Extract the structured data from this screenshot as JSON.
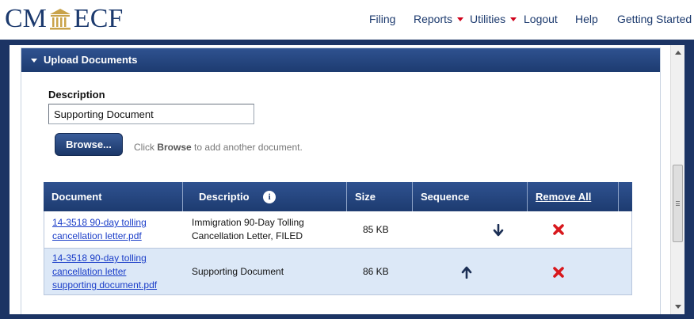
{
  "logo": {
    "left": "CM",
    "right": "ECF"
  },
  "nav": {
    "filing": "Filing",
    "reports": "Reports",
    "utilities": "Utilities",
    "logout": "Logout",
    "help": "Help",
    "getting_started": "Getting Started"
  },
  "panel": {
    "title": "Upload Documents"
  },
  "form": {
    "description_label": "Description",
    "description_value": "Supporting Document",
    "browse_label": "Browse...",
    "hint_prefix": "Click",
    "hint_bold": "Browse",
    "hint_suffix": "to add another document."
  },
  "table": {
    "headers": {
      "document": "Document",
      "description": "Descriptio",
      "size": "Size",
      "sequence": "Sequence",
      "remove_all": "Remove All"
    },
    "rows": [
      {
        "document_lines": [
          "14-3518 90-day tolling",
          "cancellation letter.pdf"
        ],
        "description_lines": [
          "Immigration 90-Day Tolling",
          "Cancellation Letter, FILED"
        ],
        "size": "85 KB"
      },
      {
        "document_lines": [
          "14-3518 90-day tolling",
          "cancellation letter",
          "supporting document.pdf"
        ],
        "description_lines": [
          "Supporting Document"
        ],
        "size": "86 KB"
      }
    ]
  },
  "colors": {
    "brand_navy": "#1c3464",
    "header_blue": "#2f5290",
    "link_blue": "#1a3dc8",
    "caret_red": "#d0021b",
    "row_highlight": "#dce8f7"
  },
  "icons": {
    "info": "info-icon",
    "move_down": "arrow-down-icon",
    "move_up": "arrow-up-icon",
    "remove": "remove-x-icon"
  }
}
